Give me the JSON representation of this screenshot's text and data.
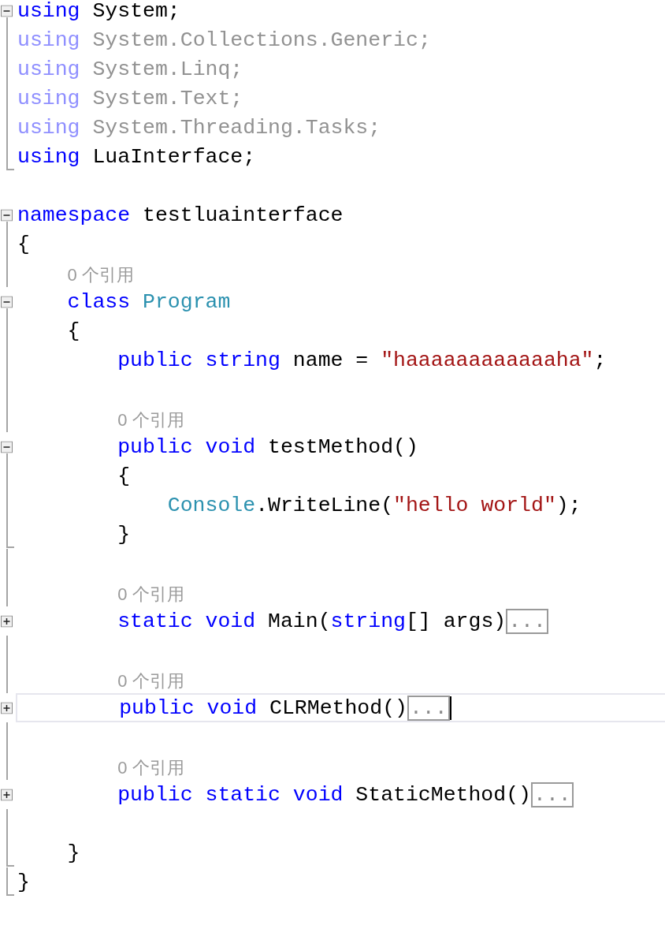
{
  "lines": [
    {
      "kind": "open",
      "unused": false,
      "tokens": [
        {
          "kind": "keyword",
          "text": "using"
        },
        {
          "kind": "plain",
          "text": " System;"
        }
      ]
    },
    {
      "kind": "inside",
      "unused": true,
      "tokens": [
        {
          "kind": "keyword",
          "text": "using"
        },
        {
          "kind": "plain",
          "text": " System.Collections.Generic;"
        }
      ]
    },
    {
      "kind": "inside",
      "unused": true,
      "tokens": [
        {
          "kind": "keyword",
          "text": "using"
        },
        {
          "kind": "plain",
          "text": " System.Linq;"
        }
      ]
    },
    {
      "kind": "inside",
      "unused": true,
      "tokens": [
        {
          "kind": "keyword",
          "text": "using"
        },
        {
          "kind": "plain",
          "text": " System.Text;"
        }
      ]
    },
    {
      "kind": "inside",
      "unused": true,
      "tokens": [
        {
          "kind": "keyword",
          "text": "using"
        },
        {
          "kind": "plain",
          "text": " System.Threading.Tasks;"
        }
      ]
    },
    {
      "kind": "end",
      "unused": false,
      "tokens": [
        {
          "kind": "keyword",
          "text": "using"
        },
        {
          "kind": "plain",
          "text": " LuaInterface;"
        }
      ]
    },
    {
      "kind": "blank"
    },
    {
      "kind": "open",
      "unused": false,
      "tokens": [
        {
          "kind": "keyword",
          "text": "namespace"
        },
        {
          "kind": "plain",
          "text": " testluainterface"
        }
      ]
    },
    {
      "kind": "inside",
      "unused": false,
      "tokens": [
        {
          "kind": "plain",
          "text": "{"
        }
      ],
      "children": [
        {
          "kind": "open",
          "unused": false,
          "references": "0 个引用",
          "tokens": [
            {
              "kind": "keyword",
              "text": "class "
            },
            {
              "kind": "type",
              "text": "Program"
            }
          ]
        },
        {
          "kind": "inside",
          "unused": false,
          "tokens": [
            {
              "kind": "plain",
              "text": "{"
            }
          ],
          "children": [
            {
              "kind": "inside",
              "unused": false,
              "tokens": [
                {
                  "kind": "keyword",
                  "text": "public string"
                },
                {
                  "kind": "plain",
                  "text": " name = "
                },
                {
                  "kind": "string",
                  "text": "\"haaaaaaaaaaaaha\""
                },
                {
                  "kind": "plain",
                  "text": ";"
                }
              ]
            },
            {
              "kind": "inside"
            },
            {
              "kind": "open",
              "unused": false,
              "references": "0 个引用",
              "tokens": [
                {
                  "kind": "keyword",
                  "text": "public void"
                },
                {
                  "kind": "plain",
                  "text": " testMethod()"
                }
              ]
            },
            {
              "kind": "inside",
              "unused": false,
              "tokens": [
                {
                  "kind": "plain",
                  "text": "{"
                }
              ],
              "children": [
                {
                  "kind": "inside",
                  "unused": false,
                  "tokens": [
                    {
                      "kind": "type",
                      "text": "Console"
                    },
                    {
                      "kind": "plain",
                      "text": ".WriteLine("
                    },
                    {
                      "kind": "string",
                      "text": "\"hello world\""
                    },
                    {
                      "kind": "plain",
                      "text": ");"
                    }
                  ]
                }
              ]
            },
            {
              "kind": "end",
              "unused": false,
              "tokens": [
                {
                  "kind": "plain",
                  "text": "}"
                }
              ]
            },
            {
              "kind": "inside"
            },
            {
              "kind": "closed",
              "unused": false,
              "references": "0 个引用",
              "tokens": [
                {
                  "kind": "keyword",
                  "text": "static void"
                },
                {
                  "kind": "plain",
                  "text": " Main("
                },
                {
                  "kind": "keyword",
                  "text": "string"
                },
                {
                  "kind": "plain",
                  "text": "[] args)"
                },
                {
                  "kind": "collapsed",
                  "text": "..."
                }
              ]
            },
            {
              "kind": "inside"
            },
            {
              "kind": "closed",
              "unused": false,
              "current": true,
              "references": "0 个引用",
              "tokens": [
                {
                  "kind": "keyword",
                  "text": "public void"
                },
                {
                  "kind": "plain",
                  "text": " CLRMethod()"
                },
                {
                  "kind": "collapsed",
                  "text": "..."
                }
              ]
            },
            {
              "kind": "inside"
            },
            {
              "kind": "closed",
              "unused": false,
              "references": "0 个引用",
              "tokens": [
                {
                  "kind": "keyword",
                  "text": "public static void"
                },
                {
                  "kind": "plain",
                  "text": " StaticMethod()"
                },
                {
                  "kind": "collapsed",
                  "text": "..."
                }
              ]
            },
            {
              "kind": "inside"
            }
          ]
        },
        {
          "kind": "end",
          "unused": false,
          "tokens": [
            {
              "kind": "plain",
              "text": "}"
            }
          ]
        }
      ]
    },
    {
      "kind": "end",
      "unused": false,
      "tokens": [
        {
          "kind": "plain",
          "text": "}"
        }
      ]
    }
  ]
}
